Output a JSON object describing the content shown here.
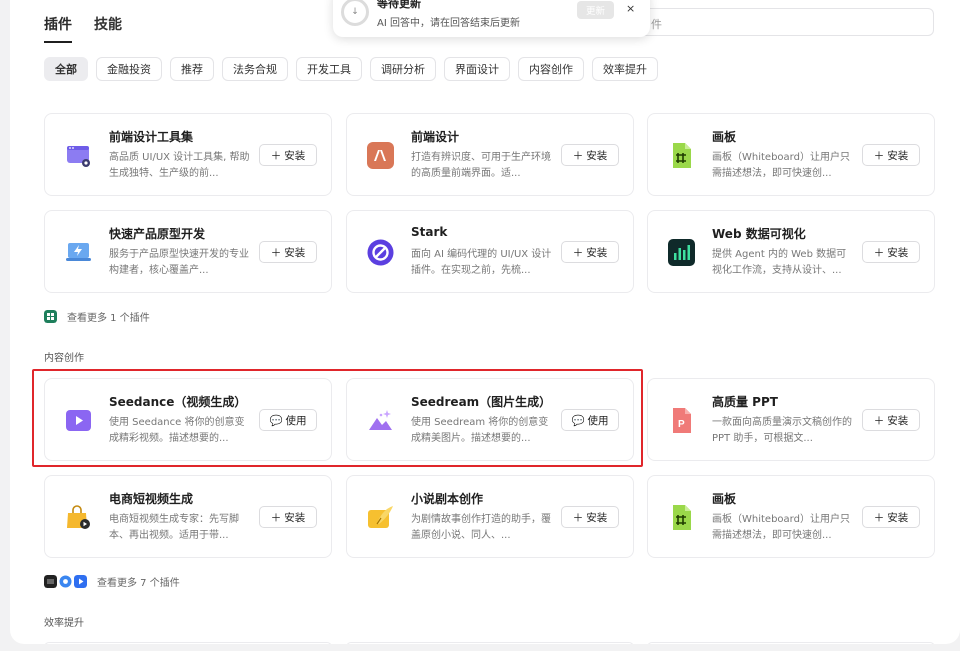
{
  "tabs": [
    {
      "label": "插件",
      "active": true
    },
    {
      "label": "技能",
      "active": false
    }
  ],
  "search": {
    "placeholder_visible": "件"
  },
  "chips": [
    "全部",
    "金融投资",
    "推荐",
    "法务合规",
    "开发工具",
    "调研分析",
    "界面设计",
    "内容创作",
    "效率提升"
  ],
  "toast": {
    "title": "等待更新",
    "message": "AI 回答中，请在回答结束后更新",
    "update_label": "更新",
    "close_label": "×"
  },
  "cards": [
    {
      "title": "前端设计工具集",
      "desc": "高品质 UI/UX 设计工具集, 帮助生成独特、生产级的前...",
      "button": "安装",
      "icon": "design-kit-icon"
    },
    {
      "title": "前端设计",
      "desc": "打造有辨识度、可用于生产环境的高质量前端界面。适...",
      "button": "安装",
      "icon": "anthropic-icon"
    },
    {
      "title": "画板",
      "desc": "画板（Whiteboard）让用户只需描述想法，即可快速创...",
      "button": "安装",
      "icon": "whiteboard-icon"
    },
    {
      "title": "快速产品原型开发",
      "desc": "服务于产品原型快速开发的专业构建者，核心覆盖产...",
      "button": "安装",
      "icon": "prototype-icon"
    },
    {
      "title": "Stark",
      "desc": "面向 AI 编码代理的 UI/UX 设计插件。在实现之前，先梳...",
      "button": "安装",
      "icon": "stark-icon"
    },
    {
      "title": "Web 数据可视化",
      "desc": "提供 Agent 内的 Web 数据可视化工作流，支持从设计、...",
      "button": "安装",
      "icon": "dataviz-icon"
    },
    {
      "title": "Seedance（视频生成）",
      "desc": "使用 Seedance 将你的创意变成精彩视频。描述想要的...",
      "button": "使用",
      "icon": "video-icon"
    },
    {
      "title": "Seedream（图片生成）",
      "desc": "使用 Seedream 将你的创意变成精美图片。描述想要的...",
      "button": "使用",
      "icon": "image-gen-icon"
    },
    {
      "title": "高质量 PPT",
      "desc": "一款面向高质量演示文稿创作的 PPT 助手，可根据文...",
      "button": "安装",
      "icon": "ppt-icon"
    },
    {
      "title": "电商短视频生成",
      "desc": "电商短视频生成专家：先写脚本、再出视频。适用于带...",
      "button": "安装",
      "icon": "ecommerce-video-icon"
    },
    {
      "title": "小说剧本创作",
      "desc": "为剧情故事创作打造的助手，覆盖原创小说、同人、...",
      "button": "安装",
      "icon": "novel-icon"
    },
    {
      "title": "画板",
      "desc": "画板（Whiteboard）让用户只需描述想法，即可快速创...",
      "button": "安装",
      "icon": "whiteboard-icon"
    }
  ],
  "more1": "查看更多 1 个插件",
  "more2": "查看更多 7 个插件",
  "sections": {
    "content": "内容创作",
    "efficiency": "效率提升"
  },
  "colors": {
    "highlight": "#e0262b",
    "accent_purple": "#7b5cf0"
  }
}
